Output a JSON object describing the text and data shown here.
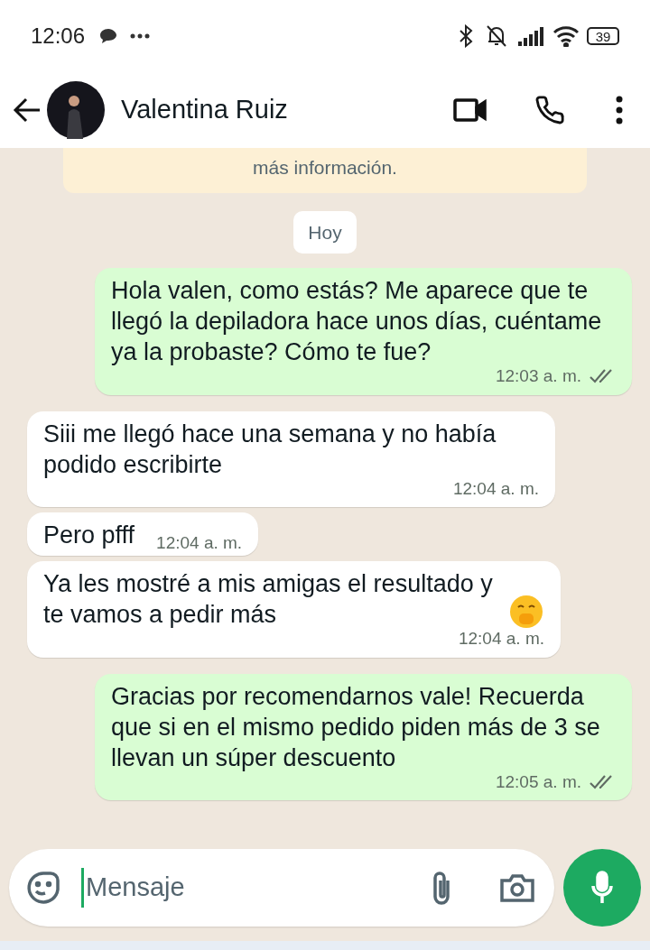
{
  "status_bar": {
    "time": "12:06",
    "battery": "39"
  },
  "header": {
    "contact_name": "Valentina Ruiz"
  },
  "notice": {
    "text": "más información."
  },
  "date_chip": "Hoy",
  "messages": [
    {
      "kind": "outgoing",
      "text": "Hola valen, como estás?  Me aparece que te llegó la depiladora hace unos días, cuéntame ya la probaste? Cómo te fue?",
      "time": "12:03 a. m.",
      "read": false
    },
    {
      "kind": "incoming",
      "text": "Siii me llegó hace una semana y no había podido escribirte",
      "time": "12:04 a. m."
    },
    {
      "kind": "incoming",
      "text": "Pero pfff",
      "time": "12:04 a. m."
    },
    {
      "kind": "incoming",
      "text": "Ya les mostré a mis amigas el resultado y te vamos a pedir más",
      "time": "12:04 a. m.",
      "emoji": true
    },
    {
      "kind": "outgoing",
      "text": "Gracias por recomendarnos vale! Recuerda que si en el mismo pedido piden más de 3 se llevan un súper descuento",
      "time": "12:05 a. m.",
      "read": false
    }
  ],
  "composer": {
    "placeholder": "Mensaje"
  }
}
